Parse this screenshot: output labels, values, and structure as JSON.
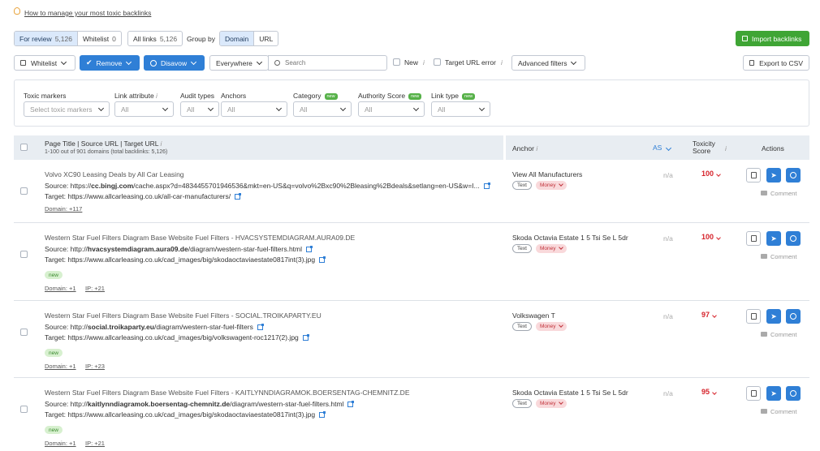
{
  "help_link": "How to manage your most toxic backlinks",
  "review_tabs": [
    {
      "label": "For review",
      "count": "5,126"
    },
    {
      "label": "Whitelist",
      "count": "0"
    }
  ],
  "all_links": {
    "label": "All links",
    "count": "5,126"
  },
  "group_by": {
    "label": "Group by",
    "options": [
      "Domain",
      "URL"
    ],
    "selected": "Domain"
  },
  "import_label": "Import backlinks",
  "toolbar": {
    "whitelist": "Whitelist",
    "remove": "Remove",
    "disavow": "Disavow",
    "scope": "Everywhere",
    "search_placeholder": "Search",
    "new_label": "New",
    "target_error_label": "Target URL error",
    "advanced": "Advanced filters",
    "export": "Export to CSV"
  },
  "filters": {
    "toxic": {
      "label": "Toxic markers",
      "value": "Select toxic markers"
    },
    "link_attr": {
      "label": "Link attribute",
      "value": "All"
    },
    "audit": {
      "label": "Audit types",
      "value": "All"
    },
    "anchors": {
      "label": "Anchors",
      "value": "All"
    },
    "category": {
      "label": "Category",
      "value": "All",
      "badge": "new"
    },
    "authority": {
      "label": "Authority Score",
      "value": "All",
      "badge": "new"
    },
    "link_type": {
      "label": "Link type",
      "value": "All",
      "badge": "new"
    }
  },
  "table": {
    "col_page": "Page Title | Source URL | Target URL",
    "summary": "1-100 out of 901 domains (total backlinks: 5,126)",
    "col_anchor": "Anchor",
    "col_as": "AS",
    "col_toxicity": "Toxicity Score",
    "col_actions": "Actions"
  },
  "rows": [
    {
      "title": "Volvo XC90 Leasing Deals by All Car Leasing",
      "source_prefix": "Source: https://",
      "source_domain": "cc.bingj.com",
      "source_rest": "/cache.aspx?d=4834455701946536&mkt=en-US&q=volvo%2Bxc90%2Bleasing%2Bdeals&setlang=en-US&w=I...",
      "target": "Target: https://www.allcarleasing.co.uk/all-car-manufacturers/",
      "badge": "",
      "domain_info": "Domain: +117",
      "ip_info": "",
      "anchor": "View All Manufacturers",
      "tag1": "Text",
      "tag2": "Money",
      "as": "n/a",
      "score": "100",
      "comment": "Comment"
    },
    {
      "title": "Western Star Fuel Filters Diagram Base Website Fuel Filters - HVACSYSTEMDIAGRAM.AURA09.DE",
      "source_prefix": "Source: http://",
      "source_domain": "hvacsystemdiagram.aura09.de",
      "source_rest": "/diagram/western-star-fuel-filters.html",
      "target": "Target: https://www.allcarleasing.co.uk/cad_images/big/skodaoctaviaestate0817int(3).jpg",
      "badge": "new",
      "domain_info": "Domain: +1",
      "ip_info": "IP: +21",
      "anchor": "Skoda Octavia Estate 1 5 Tsi Se L 5dr",
      "tag1": "Text",
      "tag2": "Money",
      "as": "n/a",
      "score": "100",
      "comment": "Comment"
    },
    {
      "title": "Western Star Fuel Filters Diagram Base Website Fuel Filters - SOCIAL.TROIKAPARTY.EU",
      "source_prefix": "Source: http://",
      "source_domain": "social.troikaparty.eu",
      "source_rest": "/diagram/western-star-fuel-filters",
      "target": "Target: https://www.allcarleasing.co.uk/cad_images/big/volkswagent-roc1217(2).jpg",
      "badge": "new",
      "domain_info": "Domain: +1",
      "ip_info": "IP: +23",
      "anchor": "Volkswagen T",
      "tag1": "Text",
      "tag2": "Money",
      "as": "n/a",
      "score": "97",
      "comment": "Comment"
    },
    {
      "title": "Western Star Fuel Filters Diagram Base Website Fuel Filters - KAITLYNNDIAGRAMOK.BOERSENTAG-CHEMNITZ.DE",
      "source_prefix": "Source: http://",
      "source_domain": "kaitlynndiagramok.boersentag-chemnitz.de",
      "source_rest": "/diagram/western-star-fuel-filters.html",
      "target": "Target: https://www.allcarleasing.co.uk/cad_images/big/skodaoctaviaestate0817int(3).jpg",
      "badge": "new",
      "domain_info": "Domain: +1",
      "ip_info": "IP: +21",
      "anchor": "Skoda Octavia Estate 1 5 Tsi Se L 5dr",
      "tag1": "Text",
      "tag2": "Money",
      "as": "n/a",
      "score": "95",
      "comment": "Comment"
    }
  ]
}
